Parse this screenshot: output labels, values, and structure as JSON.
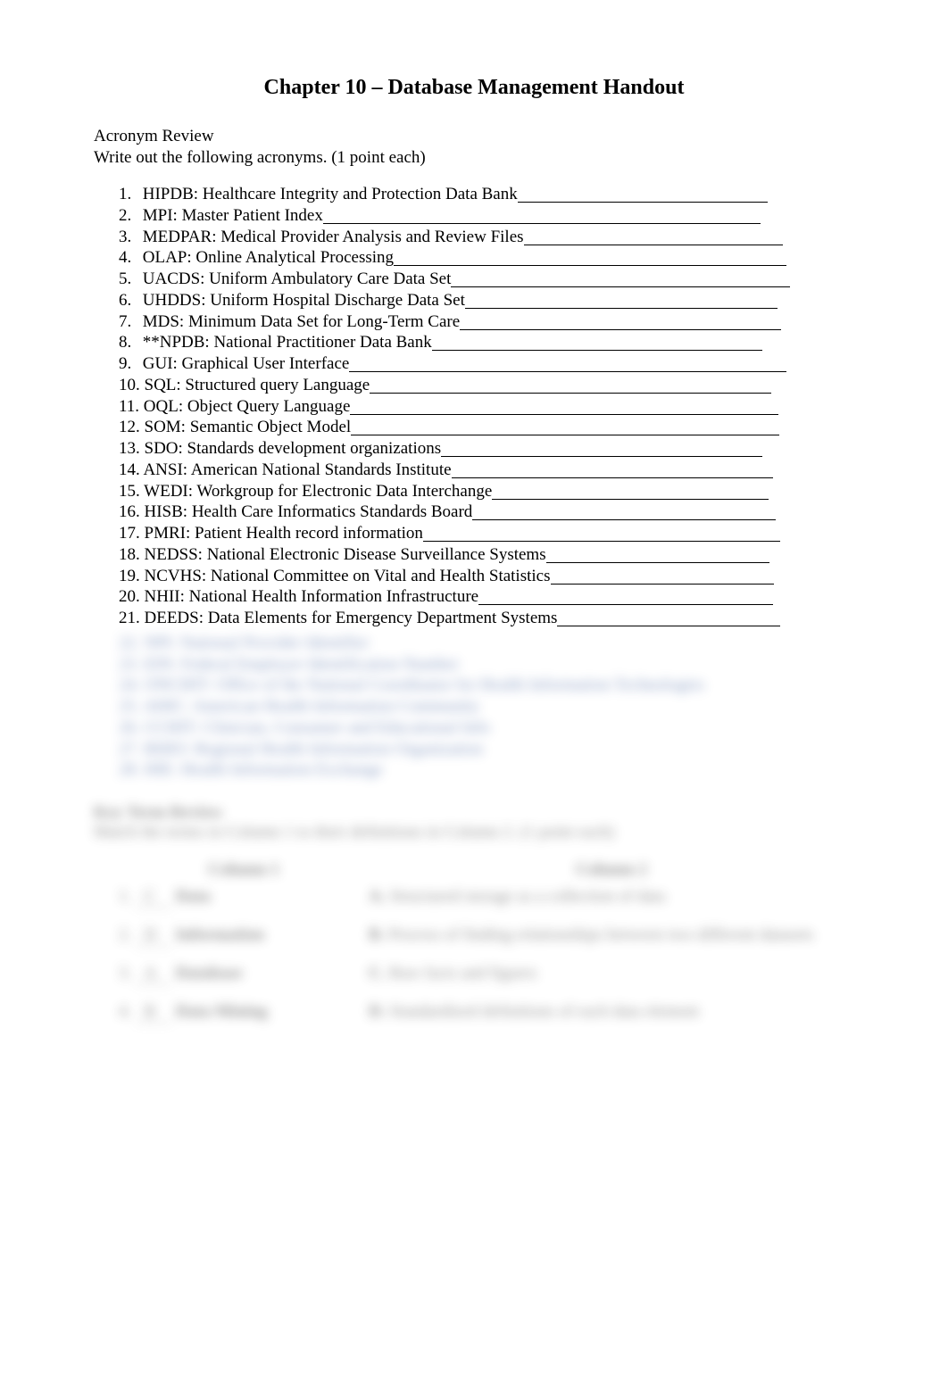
{
  "title": "Chapter 10 – Database Management Handout",
  "section_heading": "Acronym Review",
  "instructions": "Write out the following acronyms. (1 point each)",
  "acronyms": [
    {
      "num": "1.",
      "text": "HIPDB: Healthcare Integrity and Protection Data Bank",
      "fill": 280
    },
    {
      "num": "2.",
      "text": "MPI: Master Patient Index",
      "fill": 490
    },
    {
      "num": "3.",
      "text": "MEDPAR: Medical Provider Analysis and Review Files",
      "fill": 290
    },
    {
      "num": "4.",
      "text": "OLAP: Online Analytical Processing",
      "fill": 440
    },
    {
      "num": "5.",
      "text": "UACDS: Uniform Ambulatory Care Data Set",
      "fill": 380
    },
    {
      "num": "6.",
      "text": "UHDDS: Uniform Hospital Discharge Data Set",
      "fill": 350
    },
    {
      "num": "7.",
      "text": "MDS: Minimum Data Set for Long-Term Care",
      "fill": 360
    },
    {
      "num": "8.",
      "text": "**NPDB: National Practitioner Data Bank",
      "fill": 370
    },
    {
      "num": "9.",
      "text": "GUI: Graphical User Interface",
      "fill": 490
    },
    {
      "num": "10.",
      "text": "SQL: Structured query Language",
      "fill": 450
    },
    {
      "num": "11.",
      "text": "OQL: Object Query Language",
      "fill": 480
    },
    {
      "num": "12.",
      "text": "SOM: Semantic Object Model",
      "fill": 480
    },
    {
      "num": "13.",
      "text": "SDO: Standards development organizations",
      "fill": 360
    },
    {
      "num": "14.",
      "text": "ANSI: American National Standards Institute",
      "fill": 360
    },
    {
      "num": "15.",
      "text": "WEDI: Workgroup for Electronic Data Interchange",
      "fill": 310
    },
    {
      "num": "16.",
      "text": "HISB: Health Care Informatics Standards Board",
      "fill": 340
    },
    {
      "num": "17.",
      "text": "PMRI: Patient Health record information",
      "fill": 400
    },
    {
      "num": "18.",
      "text": "NEDSS: National Electronic Disease Surveillance Systems",
      "fill": 250
    },
    {
      "num": "19.",
      "text": "NCVHS: National Committee on Vital and Health Statistics",
      "fill": 250
    },
    {
      "num": "20.",
      "text": "NHII: National Health Information Infrastructure",
      "fill": 330
    },
    {
      "num": "21.",
      "text": "DEEDS: Data Elements for Emergency Department Systems",
      "fill": 250
    }
  ],
  "blurred_items": [
    "22. NPI: National Provider Identifier",
    "23. EIN: Federal Employer Identification Number",
    "24. ONCHIT: Office of the National Coordinator for Health Information Technologies",
    "25. AHIC: American Health Information Community",
    "26. CCHIT: Clinician, Consumer and Educational Info",
    "27. RHIO: Regional Health Information Organization",
    "28. HIE: Health Information Exchange"
  ],
  "blurred_heading": "Key Term Review",
  "blurred_instr": "Match the terms in Column 1 to their definitions in Column 2.  (1 point each)",
  "match_header": {
    "c1": "Column 1",
    "c2": "Column 2"
  },
  "match_rows": [
    {
      "left_num": "1.",
      "left_ans": "C",
      "left_term": "Data",
      "right_let": "A.",
      "right_def": "Structured storage as a collection of data"
    },
    {
      "left_num": "2.",
      "left_ans": "D",
      "left_term": "Information",
      "right_let": "B.",
      "right_def": "Process of finding relationships between two different datasets"
    },
    {
      "left_num": "3.",
      "left_ans": "A",
      "left_term": "Database",
      "right_let": "C.",
      "right_def": "Raw facts and figures"
    },
    {
      "left_num": "4.",
      "left_ans": "B",
      "left_term": "Data Mining",
      "right_let": "D.",
      "right_def": "Standardized definitions of each data element"
    }
  ]
}
